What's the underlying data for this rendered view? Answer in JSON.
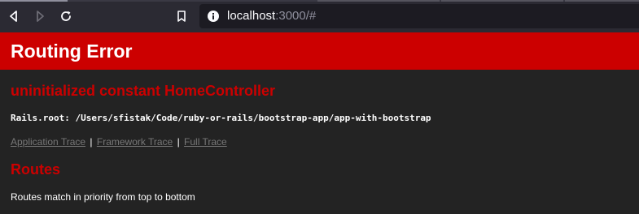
{
  "browser": {
    "url_host": "localhost",
    "url_rest": ":3000/#",
    "icons": [
      "back-icon",
      "forward-icon",
      "reload-icon",
      "bookmark-icon",
      "site-info-icon"
    ]
  },
  "page": {
    "header_title": "Routing Error",
    "error_message": "uninitialized constant HomeController",
    "rails_root": "Rails.root: /Users/sfistak/Code/ruby-or-rails/bootstrap-app/app-with-bootstrap",
    "trace_links": [
      {
        "label": "Application Trace"
      },
      {
        "label": "Framework Trace"
      },
      {
        "label": "Full Trace"
      }
    ],
    "trace_separator": "|",
    "routes_heading": "Routes",
    "routes_description": "Routes match in priority from top to bottom"
  },
  "colors": {
    "header_bg": "#cc0000",
    "heading_red": "#cc0000",
    "page_bg": "#232323",
    "chrome_bg": "#2b2a33",
    "urlbar_bg": "#1c1b22",
    "link_gray": "#777777"
  }
}
